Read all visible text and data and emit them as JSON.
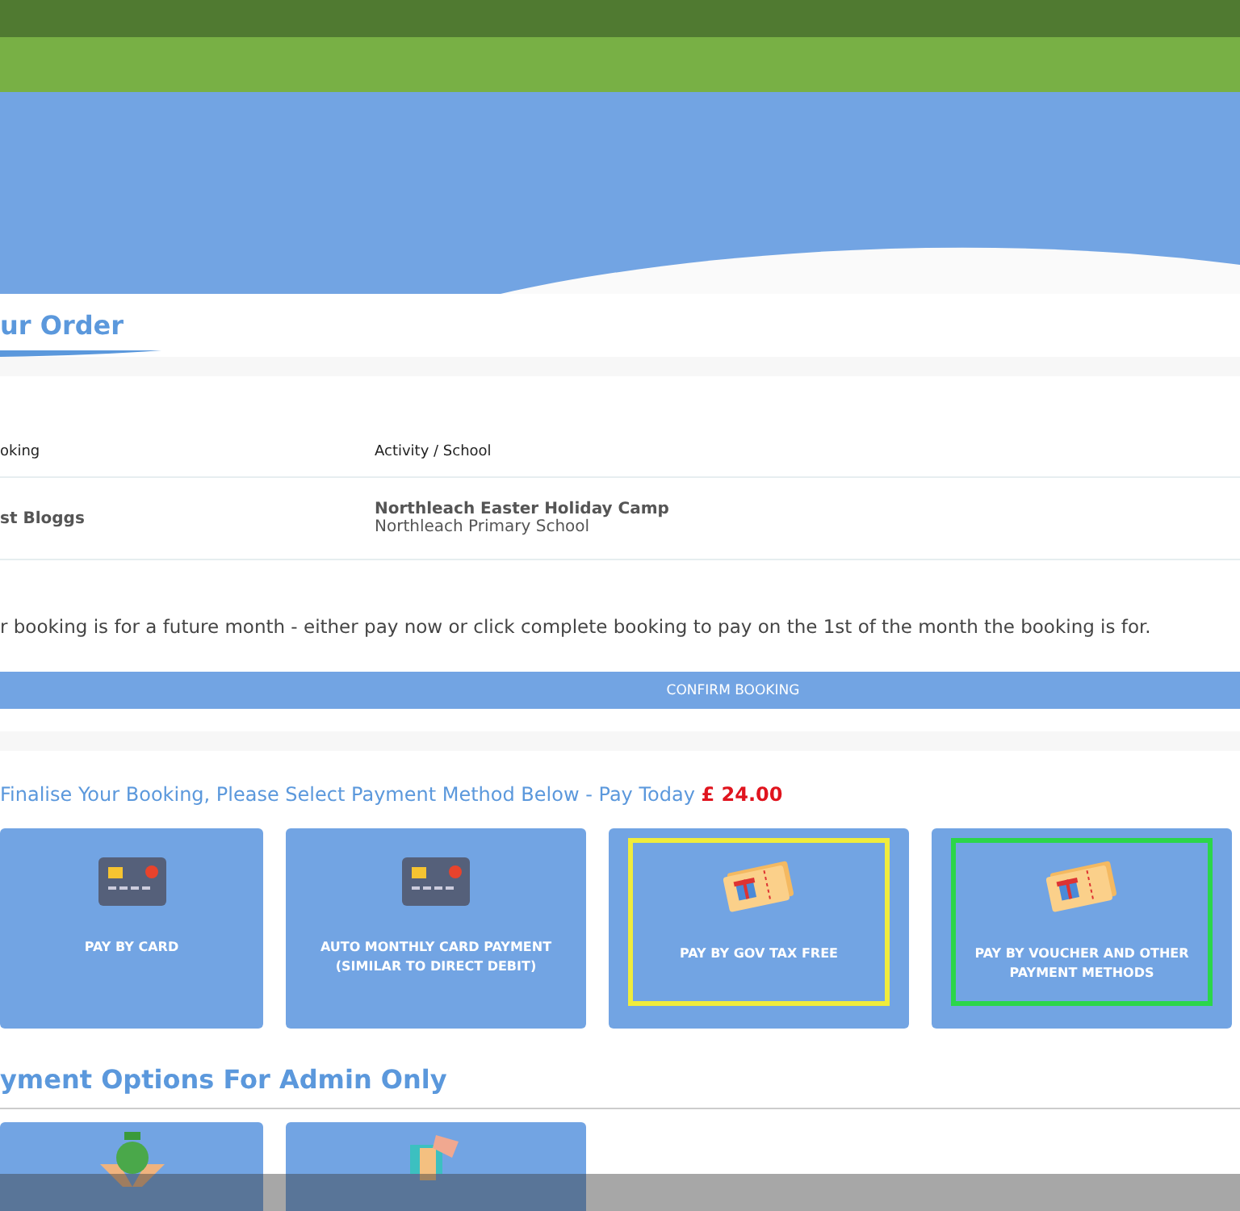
{
  "order": {
    "title": "ur Order",
    "columns": [
      "oking",
      "Activity / School"
    ],
    "rows": [
      {
        "name": "st Bloggs",
        "activity": "Northleach Easter Holiday Camp",
        "school": "Northleach Primary School"
      }
    ]
  },
  "notice": "r booking is for a future month - either pay now or click complete booking to pay on the 1st of the month the booking is for.",
  "confirm_button": "CONFIRM BOOKING",
  "payment": {
    "heading": "Finalise Your Booking, Please Select Payment Method Below - Pay Today",
    "amount": "£ 24.00",
    "methods": [
      {
        "kind": "card",
        "label": "PAY BY CARD"
      },
      {
        "kind": "card",
        "label": "AUTO MONTHLY CARD PAYMENT (SIMILAR TO DIRECT DEBIT)"
      },
      {
        "kind": "voucher",
        "label": "PAY BY GOV TAX FREE",
        "color": "#f0ec3c"
      },
      {
        "kind": "voucher",
        "label": "PAY BY VOUCHER AND OTHER PAYMENT METHODS",
        "color": "#2bd64a"
      }
    ]
  },
  "admin": {
    "heading": "yment Options For Admin Only",
    "methods": [
      {
        "kind": "cash"
      },
      {
        "kind": "transfer"
      }
    ]
  }
}
